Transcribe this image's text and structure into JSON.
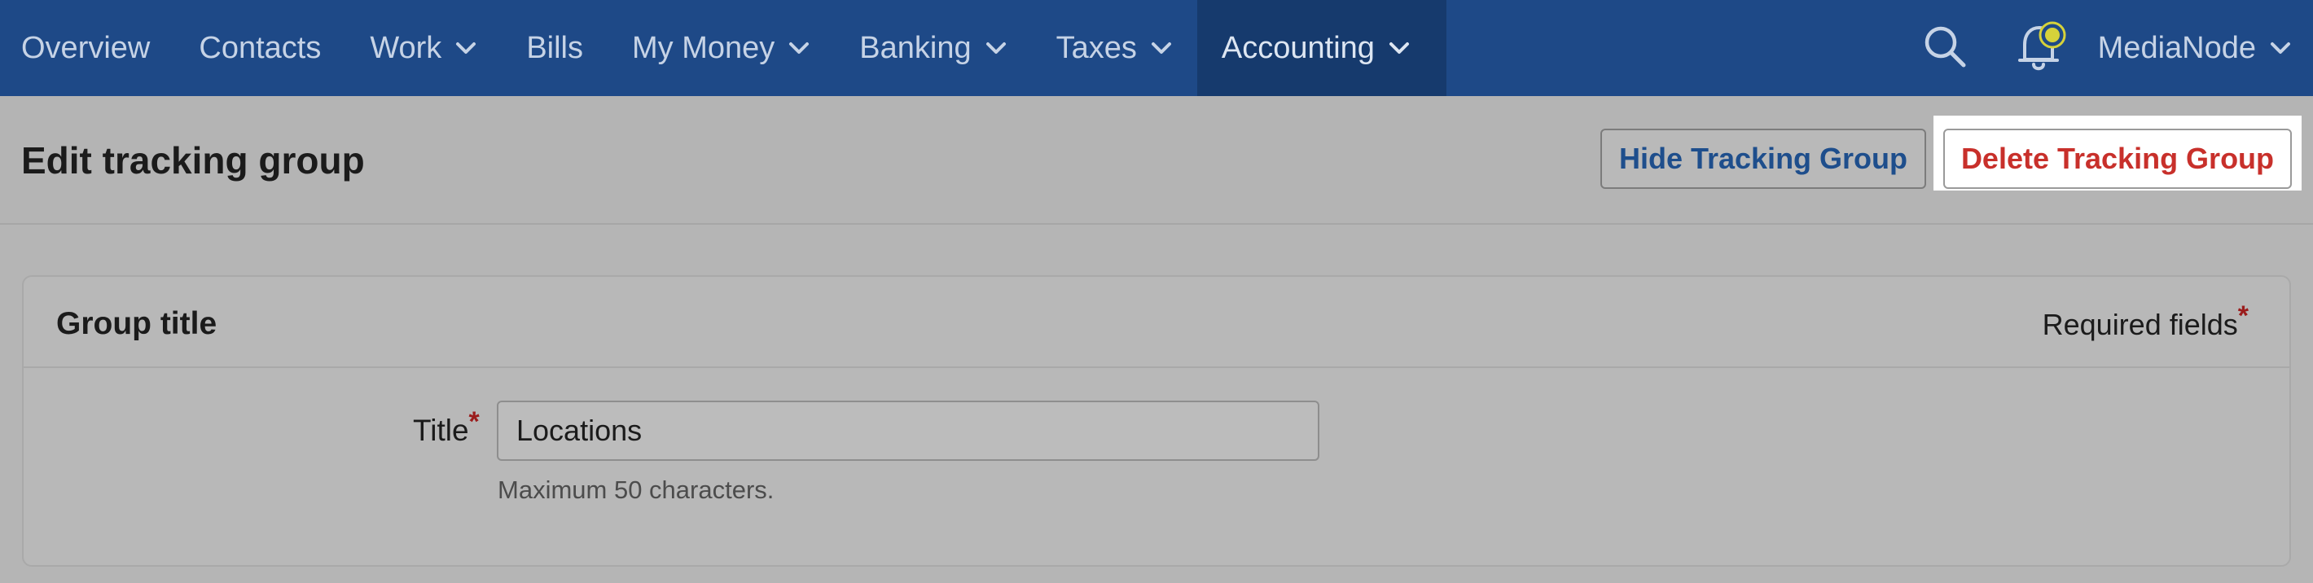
{
  "nav": {
    "items": [
      {
        "label": "Overview",
        "dropdown": false
      },
      {
        "label": "Contacts",
        "dropdown": false
      },
      {
        "label": "Work",
        "dropdown": true
      },
      {
        "label": "Bills",
        "dropdown": false
      },
      {
        "label": "My Money",
        "dropdown": true
      },
      {
        "label": "Banking",
        "dropdown": true
      },
      {
        "label": "Taxes",
        "dropdown": true
      },
      {
        "label": "Accounting",
        "dropdown": true,
        "active": true
      }
    ],
    "account_label": "MediaNode",
    "icons": [
      "search-icon",
      "bell-icon",
      "chevron-down-icon"
    ],
    "colors": {
      "bar": "#1e4987",
      "active": "#163a6d",
      "notification_dot": "#d6d23a"
    }
  },
  "header": {
    "title": "Edit tracking group",
    "hide_button": "Hide Tracking Group",
    "delete_button": "Delete Tracking Group"
  },
  "card": {
    "title": "Group title",
    "required_label": "Required fields",
    "required_marker": "*",
    "field": {
      "label": "Title",
      "value": "Locations",
      "hint": "Maximum 50 characters."
    }
  }
}
